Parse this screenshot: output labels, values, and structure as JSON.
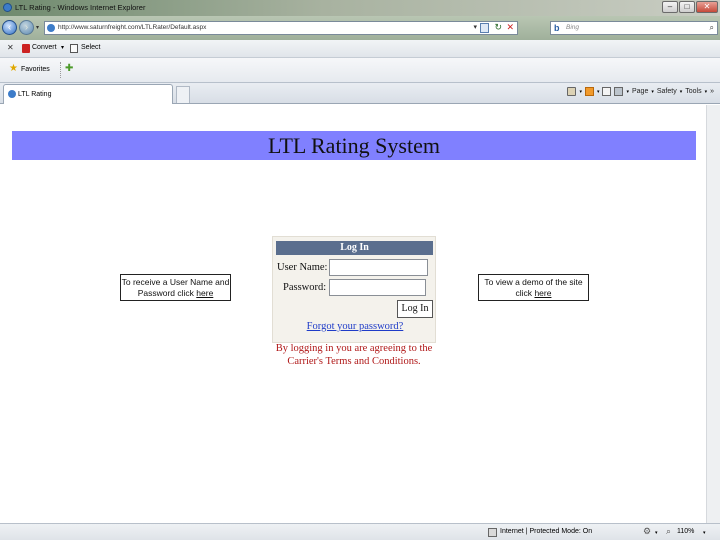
{
  "window": {
    "title": "LTL Rating - Windows Internet Explorer"
  },
  "address_bar": {
    "url": "http://www.saturnfreight.com/LTLRater/Default.aspx",
    "search_placeholder": "Bing"
  },
  "command_bar": {
    "convert_label": "Convert",
    "select_label": "Select"
  },
  "favorites_bar": {
    "favorites_label": "Favorites"
  },
  "tabs": [
    {
      "label": "LTL Rating"
    }
  ],
  "toolbar": {
    "page_label": "Page",
    "safety_label": "Safety",
    "tools_label": "Tools"
  },
  "page": {
    "title": "LTL Rating System",
    "login": {
      "header": "Log In",
      "username_label": "User Name:",
      "password_label": "Password:",
      "login_button": "Log In",
      "forgot_link": "Forgot your password?"
    },
    "terms_text": "By logging in you are agreeing to the Carrier's Terms and Conditions.",
    "left_box": {
      "text": "To receive a User Name and Password click",
      "link": "here"
    },
    "right_box": {
      "text": "To view a demo of the site click",
      "link": "here"
    }
  },
  "status_bar": {
    "zone": "Internet | Protected Mode: On",
    "zoom": "110%"
  }
}
